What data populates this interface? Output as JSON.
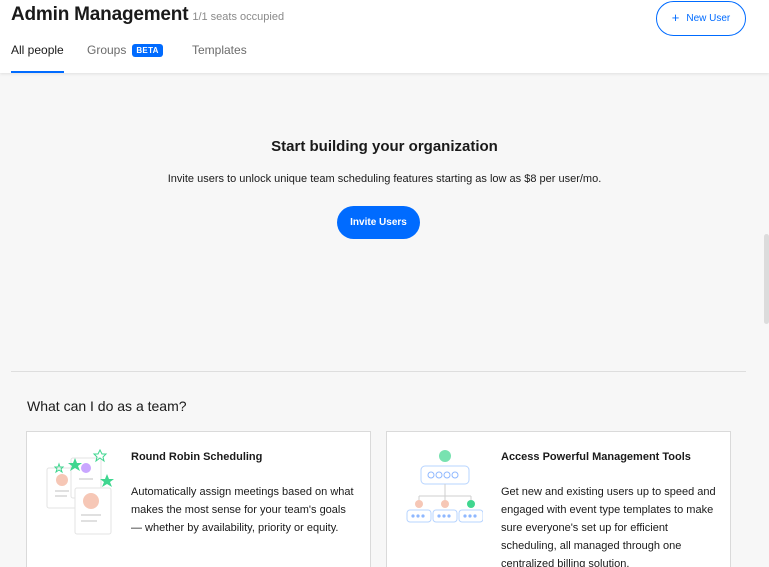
{
  "header": {
    "title": "Admin Management",
    "seats": "1/1 seats occupied",
    "new_user_label": "New User"
  },
  "tabs": [
    {
      "label": "All people",
      "active": true
    },
    {
      "label": "Groups",
      "badge": "BETA",
      "active": false
    },
    {
      "label": "Templates",
      "active": false
    }
  ],
  "empty_state": {
    "heading": "Start building your organization",
    "subtext": "Invite users to unlock unique team scheduling features starting as low as $8 per user/mo.",
    "invite_label": "Invite Users"
  },
  "team_section": {
    "heading": "What can I do as a team?",
    "cards": [
      {
        "title": "Round Robin Scheduling",
        "description": "Automatically assign meetings based on what makes the most sense for your team's goals — whether by availability, priority or equity.",
        "icon": "round-robin-illustration"
      },
      {
        "title": "Access Powerful Management Tools",
        "description": "Get new and existing users up to speed and engaged with event type templates to make sure everyone's set up for efficient scheduling, all managed through one centralized billing solution.",
        "icon": "management-tree-illustration"
      }
    ]
  },
  "colors": {
    "accent": "#006bff",
    "background": "#f7f7f7",
    "green": "#3fd68f"
  }
}
